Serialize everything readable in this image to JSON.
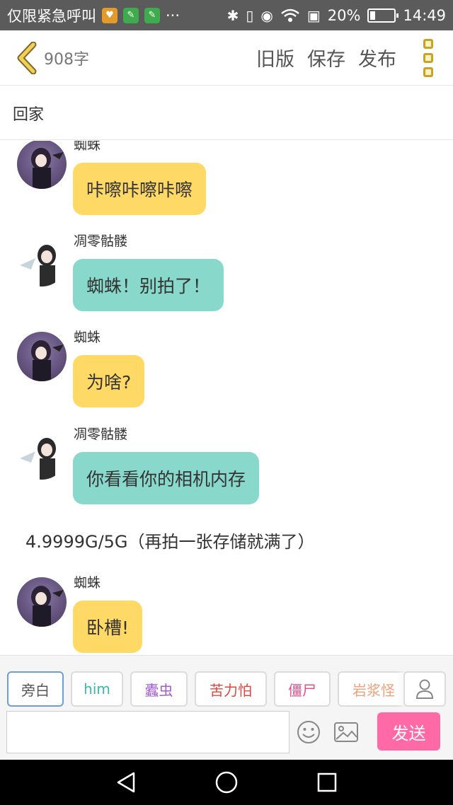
{
  "status_bar": {
    "carrier": "仅限紧急呼叫",
    "more": "···",
    "battery": "20%",
    "time": "14:49"
  },
  "toolbar": {
    "word_count": "908字",
    "old_version": "旧版",
    "save": "保存",
    "publish": "发布"
  },
  "story": {
    "title": "回家"
  },
  "messages": [
    {
      "type": "chat",
      "speaker": "蜘蛛",
      "text": "咔嚓咔嚓咔嚓",
      "color": "#ffd966"
    },
    {
      "type": "chat",
      "speaker": "凋零骷髅",
      "text": "蜘蛛！别拍了！",
      "color": "#88d8cb"
    },
    {
      "type": "chat",
      "speaker": "蜘蛛",
      "text": "为啥?",
      "color": "#ffd966"
    },
    {
      "type": "chat",
      "speaker": "凋零骷髅",
      "text": "你看看你的相机内存",
      "color": "#88d8cb"
    },
    {
      "type": "narration",
      "text": "4.9999G/5G（再拍一张存储就满了）"
    },
    {
      "type": "chat",
      "speaker": "蜘蛛",
      "text": "卧槽!",
      "color": "#ffd966"
    }
  ],
  "roles": [
    {
      "label": "旁白",
      "color": "#555555"
    },
    {
      "label": "him",
      "color": "#3bb6b0"
    },
    {
      "label": "蠹虫",
      "color": "#a35bd1"
    },
    {
      "label": "苦力怕",
      "color": "#e0463e"
    },
    {
      "label": "僵尸",
      "color": "#e0508a"
    },
    {
      "label": "岩浆怪",
      "color": "#f0a07a"
    }
  ],
  "composer": {
    "input_value": "",
    "send_label": "发送"
  },
  "colors": {
    "accent": "#ff6aa6",
    "yellow_bubble": "#ffd966",
    "teal_bubble": "#88d8cb",
    "status_bar": "#5b5b5b"
  }
}
